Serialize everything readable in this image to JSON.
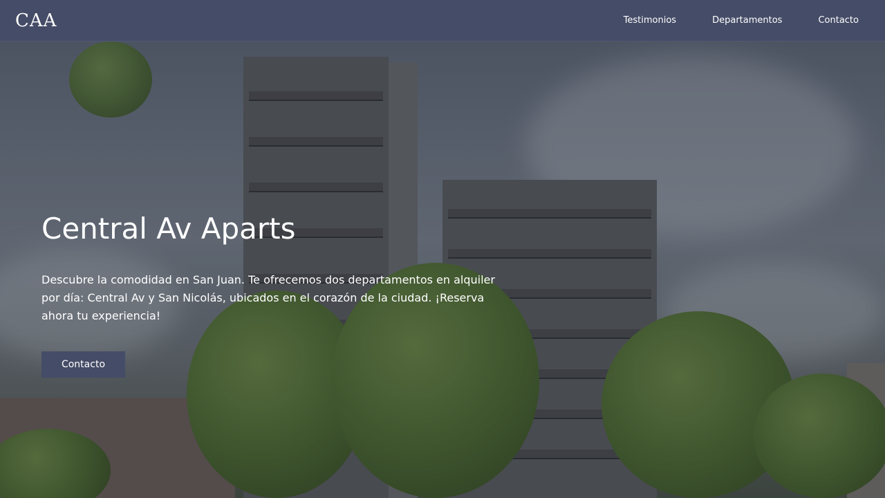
{
  "header": {
    "logo": "CAA",
    "nav": [
      "Testimonios",
      "Departamentos",
      "Contacto"
    ]
  },
  "hero": {
    "title": "Central Av Aparts",
    "description": "Descubre la comodidad en San Juan. Te ofrecemos dos departamentos en alquiler por día: Central Av y San Nicolás, ubicados en el corazón de la ciudad. ¡Reserva ahora tu experiencia!",
    "cta_label": "Contacto",
    "background_image": "building-exterior-photo"
  },
  "colors": {
    "header_bg": "#454c67",
    "button_bg": "#454c67",
    "text": "#ffffff"
  }
}
